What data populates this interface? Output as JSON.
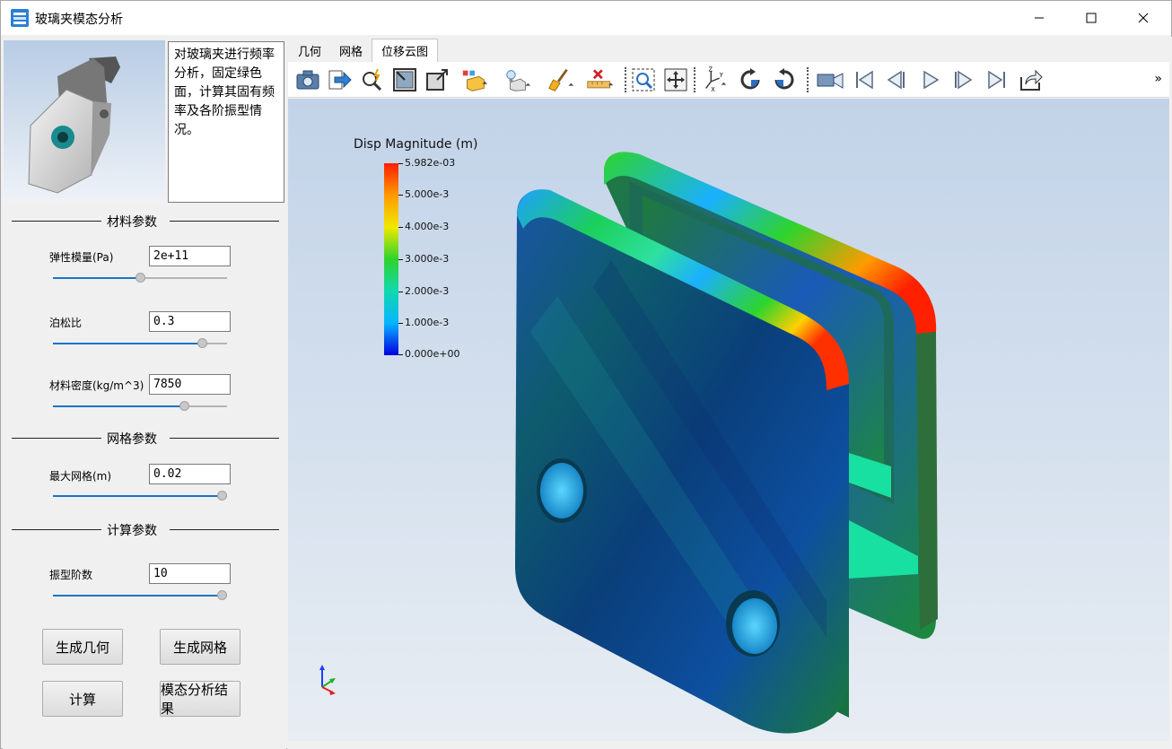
{
  "window": {
    "title": "玻璃夹模态分析",
    "controls": {
      "minimize_icon": "minimize-icon",
      "maximize_icon": "maximize-icon",
      "close_icon": "close-icon"
    }
  },
  "description": "对玻璃夹进行频率分析，固定绿色面，计算其固有频率及各阶振型情况。",
  "material_section": {
    "title": "材料参数",
    "params": [
      {
        "label": "弹性模量(Pa)",
        "value": "2e+11",
        "slider": 0.5
      },
      {
        "label": "泊松比",
        "value": "0.3",
        "slider": 0.88
      },
      {
        "label": "材料密度(kg/m^3)",
        "value": "7850",
        "slider": 0.77
      }
    ]
  },
  "mesh_section": {
    "title": "网格参数",
    "params": [
      {
        "label": "最大网格(m)",
        "value": "0.02",
        "slider": 1.0
      }
    ]
  },
  "compute_section": {
    "title": "计算参数",
    "params": [
      {
        "label": "振型阶数",
        "value": "10",
        "slider": 1.0
      }
    ]
  },
  "buttons": {
    "gen_geometry": "生成几何",
    "gen_mesh": "生成网格",
    "compute": "计算",
    "modal_result": "模态分析结果"
  },
  "tabs": [
    {
      "label": "几何"
    },
    {
      "label": "网格"
    },
    {
      "label": "位移云图",
      "active": true
    }
  ],
  "toolbar": {
    "icons": [
      "camera-icon",
      "export-icon",
      "zoom-magic-icon",
      "fit-view-icon",
      "expand-icon",
      "color-map-icon",
      "render-mode-icon",
      "brush-icon",
      "ruler-clear-icon",
      "zoom-box-icon",
      "pan-icon",
      "axes-icon",
      "rotate-cw-icon",
      "rotate-ccw-icon",
      "video-camera-icon",
      "first-frame-icon",
      "prev-frame-icon",
      "play-icon",
      "next-frame-icon",
      "last-frame-icon",
      "share-icon"
    ],
    "more": "»"
  },
  "colorbar": {
    "title": "Disp Magnitude (m)",
    "labels": [
      "5.982e-03",
      "5.000e-3",
      "4.000e-3",
      "3.000e-3",
      "2.000e-3",
      "1.000e-3",
      "0.000e+00"
    ],
    "colors": [
      "#ff1e00",
      "#ff9a00",
      "#f0e800",
      "#2ed42c",
      "#10d8b0",
      "#08b4ff",
      "#0000e0"
    ]
  }
}
